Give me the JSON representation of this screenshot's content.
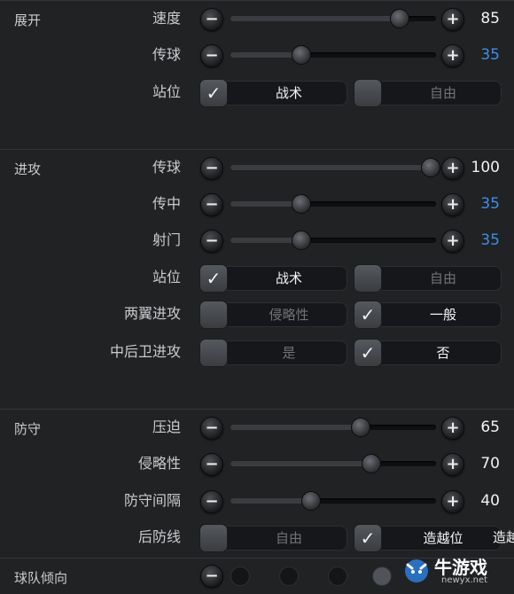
{
  "sections": {
    "development": {
      "label": "展开",
      "rows": [
        {
          "label": "速度",
          "value": "85",
          "fraction": 0.82
        },
        {
          "label": "传球",
          "value": "35",
          "fraction": 0.34
        },
        {
          "label": "站位",
          "opt1": "战术",
          "opt1_checked": true,
          "opt2": "自由",
          "opt2_checked": false
        }
      ]
    },
    "attack": {
      "label": "进攻",
      "rows": [
        {
          "label": "传球",
          "value": "100",
          "fraction": 0.97
        },
        {
          "label": "传中",
          "value": "35",
          "fraction": 0.34
        },
        {
          "label": "射门",
          "value": "35",
          "fraction": 0.34
        },
        {
          "label": "站位",
          "opt1": "战术",
          "opt1_checked": true,
          "opt2": "自由",
          "opt2_checked": false
        },
        {
          "label": "两翼进攻",
          "opt1": "侵略性",
          "opt1_checked": false,
          "opt2": "一般",
          "opt2_checked": true
        },
        {
          "label": "中后卫进攻",
          "opt1": "是",
          "opt1_checked": false,
          "opt2": "否",
          "opt2_checked": true
        }
      ]
    },
    "defense": {
      "label": "防守",
      "rows": [
        {
          "label": "压迫",
          "value": "65",
          "fraction": 0.63
        },
        {
          "label": "侵略性",
          "value": "70",
          "fraction": 0.68
        },
        {
          "label": "防守间隔",
          "value": "40",
          "fraction": 0.39
        },
        {
          "label": "后防线",
          "opt1": "自由",
          "opt1_checked": false,
          "opt2": "造越位",
          "opt2_checked": true,
          "overflow": "造越"
        }
      ]
    },
    "team": {
      "label": "球队倾向"
    }
  },
  "icons": {
    "minus": "minus-icon",
    "plus": "plus-icon",
    "check": "check-icon"
  },
  "glyphs": {
    "minus": "−",
    "plus": "+",
    "check": "✓"
  },
  "watermark": {
    "main": "牛游戏",
    "sub": "newyx.net"
  },
  "colors": {
    "blue_value": "#3d8ee6",
    "background": "#212224"
  }
}
